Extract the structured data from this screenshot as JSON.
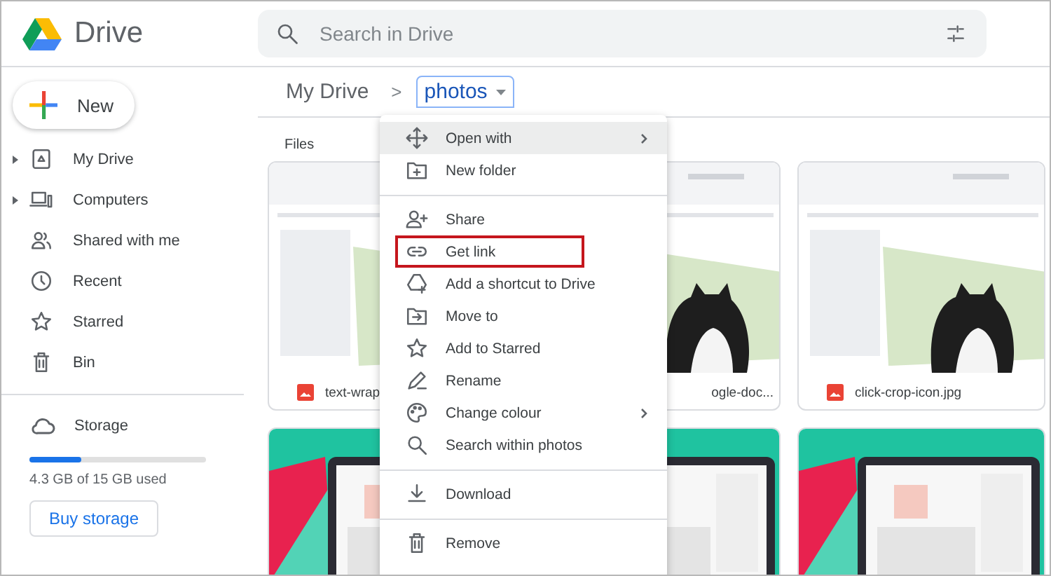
{
  "app": {
    "name": "Drive"
  },
  "search": {
    "placeholder": "Search in Drive"
  },
  "new_button": {
    "label": "New"
  },
  "sidebar": {
    "items": [
      {
        "label": "My Drive",
        "kind": "tree",
        "expanded": false
      },
      {
        "label": "Computers",
        "kind": "tree",
        "expanded": false
      },
      {
        "label": "Shared with me",
        "kind": "view"
      },
      {
        "label": "Recent",
        "kind": "view"
      },
      {
        "label": "Starred",
        "kind": "view"
      },
      {
        "label": "Bin",
        "kind": "view"
      }
    ]
  },
  "storage": {
    "label": "Storage",
    "level": 0.29,
    "usage": "4.3 GB of 15 GB used",
    "button": "Buy storage"
  },
  "breadcrumb": {
    "items": [
      {
        "label": "My Drive",
        "selected": false
      },
      {
        "label": "photos",
        "selected": true
      }
    ],
    "separator": ">"
  },
  "section": "Files",
  "files": [
    {
      "kind": "picture",
      "name": "text-wrap",
      "file_icon": true
    },
    {
      "kind": "picture",
      "name": "ogle-doc...",
      "file_icon": false
    },
    {
      "kind": "picture",
      "name": "click-crop-icon.jpg",
      "file_icon": true
    },
    {
      "kind": "picture"
    },
    {
      "kind": "picture"
    },
    {
      "kind": "picture"
    }
  ],
  "context_menu": {
    "items": [
      {
        "kind": "item",
        "label": "Open with",
        "selected": true,
        "submenu": true,
        "marked": false
      },
      {
        "kind": "item",
        "label": "New folder",
        "selected": false,
        "submenu": false,
        "marked": false
      },
      {
        "kind": "divider"
      },
      {
        "kind": "item",
        "label": "Share",
        "selected": false,
        "submenu": false,
        "marked": false
      },
      {
        "kind": "item",
        "label": "Get link",
        "selected": false,
        "submenu": false,
        "marked": true
      },
      {
        "kind": "item",
        "label": "Add a shortcut to Drive",
        "selected": false,
        "submenu": false,
        "marked": false
      },
      {
        "kind": "item",
        "label": "Move to",
        "selected": false,
        "submenu": false,
        "marked": false
      },
      {
        "kind": "item",
        "label": "Add to Starred",
        "selected": false,
        "submenu": false,
        "marked": false
      },
      {
        "kind": "item",
        "label": "Rename",
        "selected": false,
        "submenu": false,
        "marked": false
      },
      {
        "kind": "item",
        "label": "Change colour",
        "selected": false,
        "submenu": true,
        "marked": false
      },
      {
        "kind": "item",
        "label": "Search within photos",
        "selected": false,
        "submenu": false,
        "marked": false
      },
      {
        "kind": "divider"
      },
      {
        "kind": "item",
        "label": "Download",
        "selected": false,
        "submenu": false,
        "marked": false
      },
      {
        "kind": "divider"
      },
      {
        "kind": "item",
        "label": "Remove",
        "selected": false,
        "submenu": false,
        "marked": false
      }
    ]
  }
}
